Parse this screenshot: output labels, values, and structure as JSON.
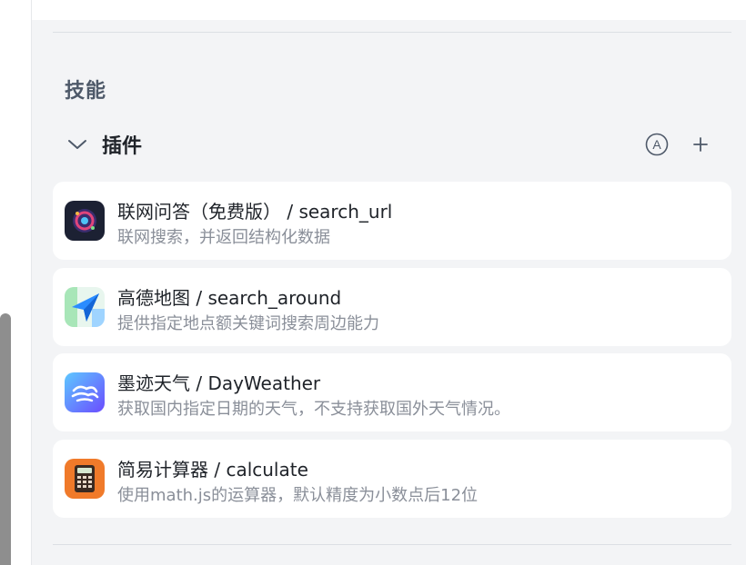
{
  "section": {
    "title": "技能"
  },
  "plugins": {
    "title": "插件",
    "auto_label": "A",
    "add_label": "+",
    "items": [
      {
        "name": "联网问答（免费版） / search_url",
        "desc": "联网搜索，并返回结构化数据",
        "icon": "search-url-icon"
      },
      {
        "name": "高德地图 / search_around",
        "desc": "提供指定地点额关键词搜索周边能力",
        "icon": "amap-icon"
      },
      {
        "name": "墨迹天气 / DayWeather",
        "desc": "获取国内指定日期的天气，不支持获取国外天气情况。",
        "icon": "moji-weather-icon"
      },
      {
        "name": "简易计算器 / calculate",
        "desc": "使用math.js的运算器，默认精度为小数点后12位",
        "icon": "calculator-icon"
      }
    ]
  },
  "colors": {
    "accent": "#2f6bff",
    "muted": "#8a8f99",
    "card": "#ffffff"
  }
}
